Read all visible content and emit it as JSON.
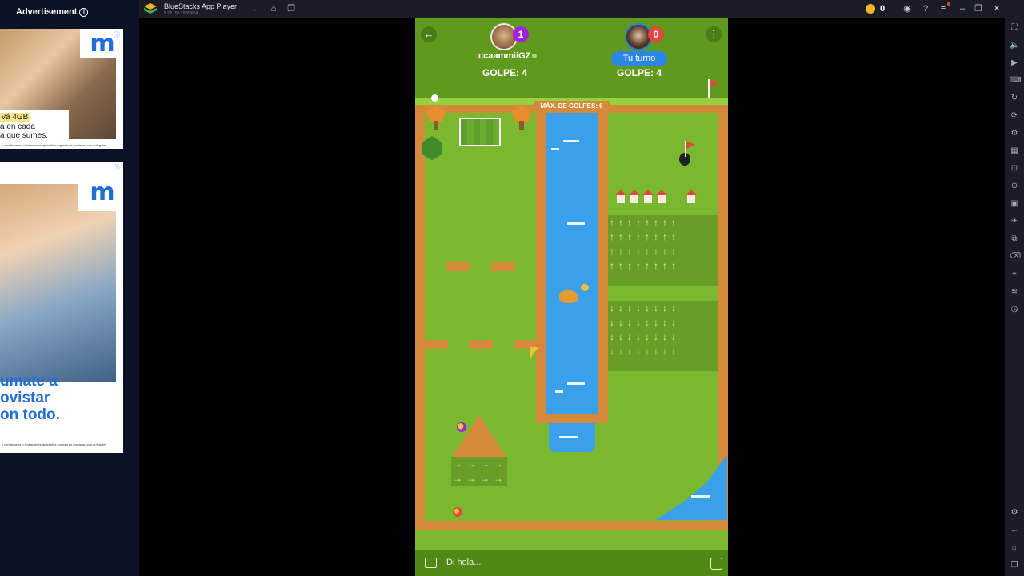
{
  "advertisement": {
    "header": "Advertisement",
    "ad1": {
      "line1": "vá 4GB",
      "line2": "a en cada",
      "line3": "a que sumes.",
      "fine_print": "y condiciones o limitaciones aplicables ingresá en movistar.com.ar/legales"
    },
    "ad2": {
      "line1": "umate a",
      "line2": "ovistar",
      "line3": "on todo.",
      "fine_print": "y condiciones o limitaciones aplicables ingresá en movistar.com.ar/legales"
    },
    "brand_color": "#1f6fd6"
  },
  "emulator": {
    "title": "BlueStacks App Player",
    "version": "5.22.150.1026 P64",
    "coins": "0"
  },
  "game": {
    "player1": {
      "name": "ccaammiiGZ",
      "badge": "1",
      "score_label": "GOLPE: 4"
    },
    "player2": {
      "badge": "0",
      "turn_label": "Tu turno",
      "score_label": "GOLPE: 4"
    },
    "max_strokes": "MÁX. DE GOLPES: 6",
    "chat_placeholder": "Di hola...",
    "colors": {
      "grass": "#7ab82f",
      "wall": "#d48a3a",
      "water": "#3aa0ea",
      "accent_blue": "#2c86e7",
      "badge_purple": "#a223d9",
      "badge_red": "#e5463f"
    }
  }
}
